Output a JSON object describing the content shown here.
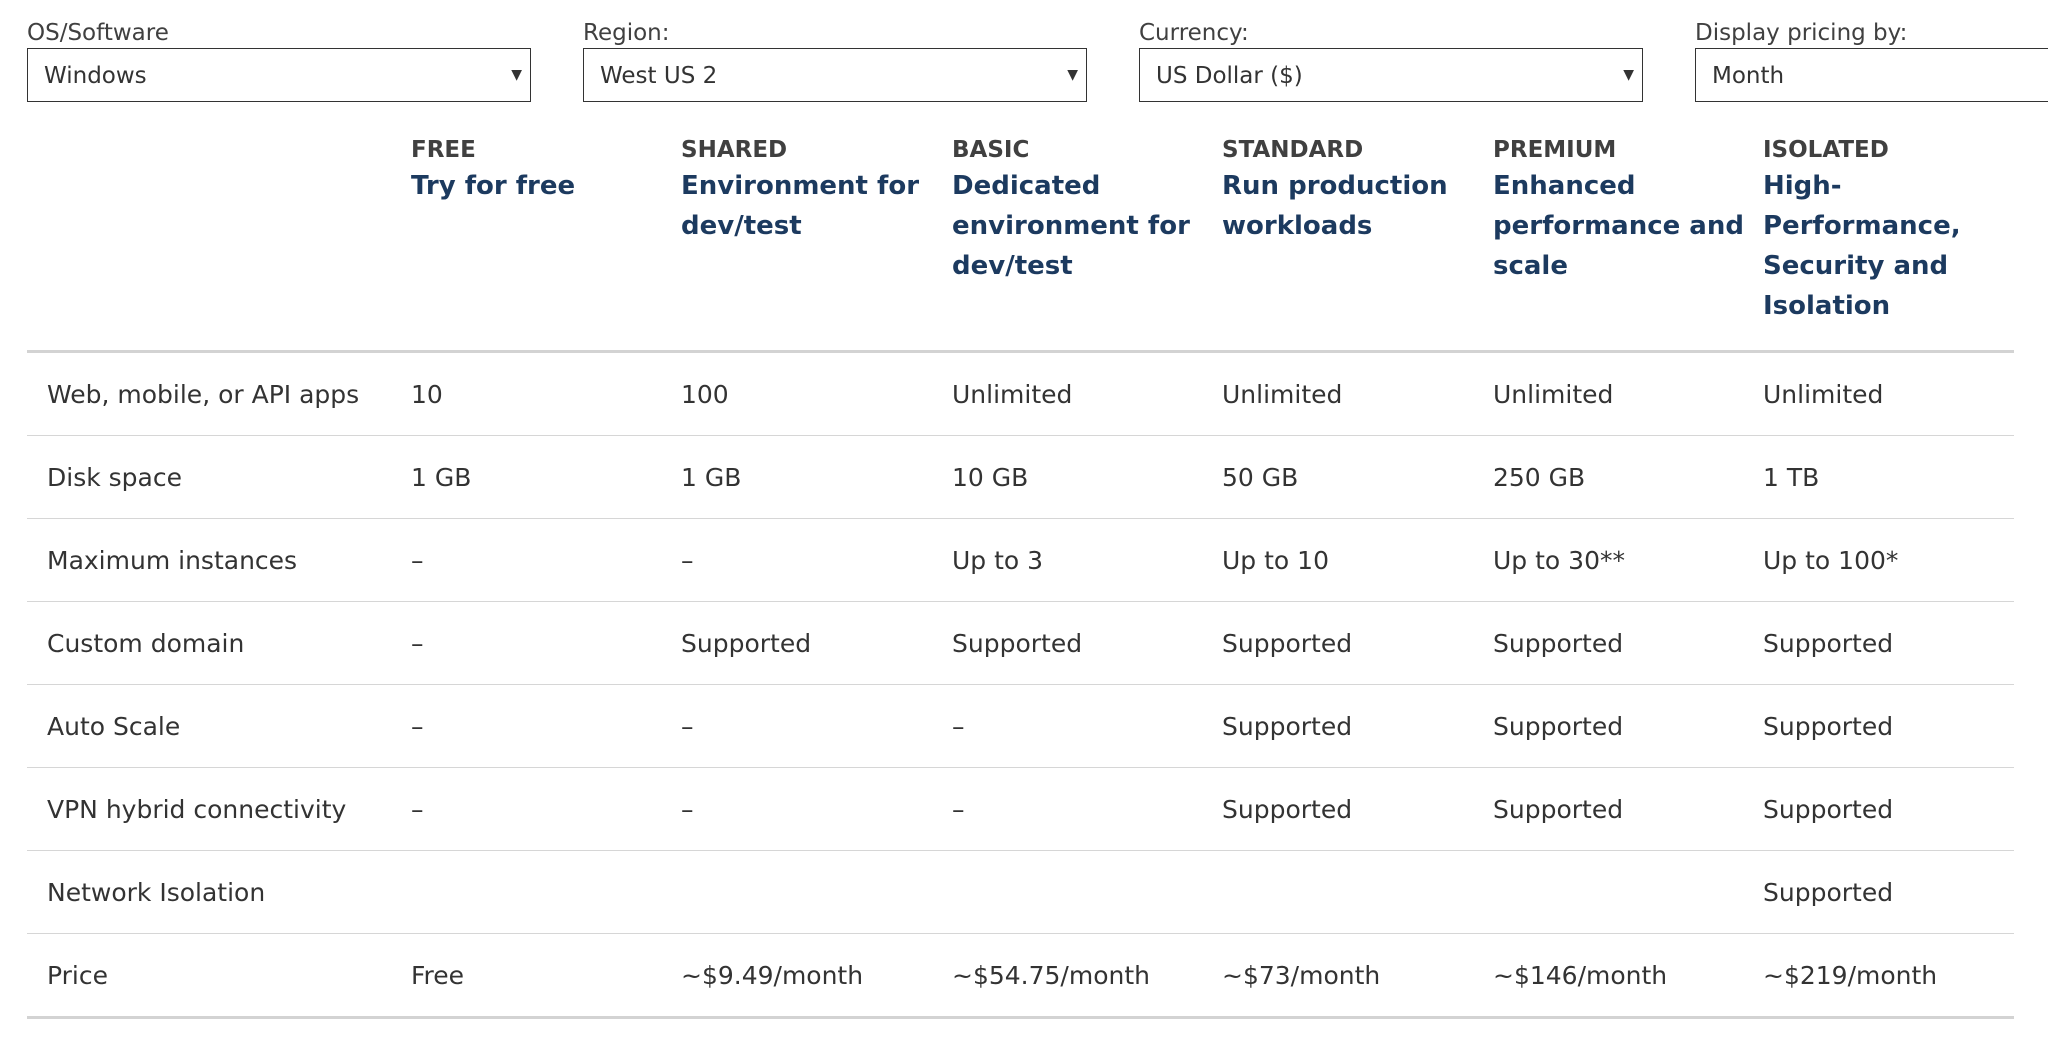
{
  "filters": {
    "os": {
      "label": "OS/Software",
      "value": "Windows"
    },
    "region": {
      "label": "Region:",
      "value": "West US 2"
    },
    "currency": {
      "label": "Currency:",
      "value": "US Dollar ($)"
    },
    "display": {
      "label": "Display pricing by:",
      "value": "Month"
    }
  },
  "tiers": [
    {
      "name": "FREE",
      "desc": "Try for free"
    },
    {
      "name": "SHARED",
      "desc": "Environment for dev/test"
    },
    {
      "name": "BASIC",
      "desc": "Dedicated environment for dev/test"
    },
    {
      "name": "STANDARD",
      "desc": "Run production workloads"
    },
    {
      "name": "PREMIUM",
      "desc": "Enhanced performance and scale"
    },
    {
      "name": "ISOLATED",
      "desc": "High-Performance, Security and Isolation"
    }
  ],
  "rows": [
    {
      "feature": "Web, mobile, or API apps",
      "values": [
        "10",
        "100",
        "Unlimited",
        "Unlimited",
        "Unlimited",
        "Unlimited"
      ]
    },
    {
      "feature": "Disk space",
      "values": [
        "1 GB",
        "1 GB",
        "10 GB",
        "50 GB",
        "250 GB",
        "1 TB"
      ]
    },
    {
      "feature": "Maximum instances",
      "values": [
        "–",
        "–",
        "Up to 3",
        "Up to 10",
        "Up to 30**",
        "Up to 100*"
      ]
    },
    {
      "feature": "Custom domain",
      "values": [
        "–",
        "Supported",
        "Supported",
        "Supported",
        "Supported",
        "Supported"
      ]
    },
    {
      "feature": "Auto Scale",
      "values": [
        "–",
        "–",
        "–",
        "Supported",
        "Supported",
        "Supported"
      ]
    },
    {
      "feature": "VPN hybrid connectivity",
      "values": [
        "–",
        "–",
        "–",
        "Supported",
        "Supported",
        "Supported"
      ]
    },
    {
      "feature": "Network Isolation",
      "values": [
        "",
        "",
        "",
        "",
        "",
        "Supported"
      ]
    },
    {
      "feature": "Price",
      "values": [
        "Free",
        "~$9.49/month",
        "~$54.75/month",
        "~$73/month",
        "~$146/month",
        "~$219/month"
      ]
    }
  ]
}
